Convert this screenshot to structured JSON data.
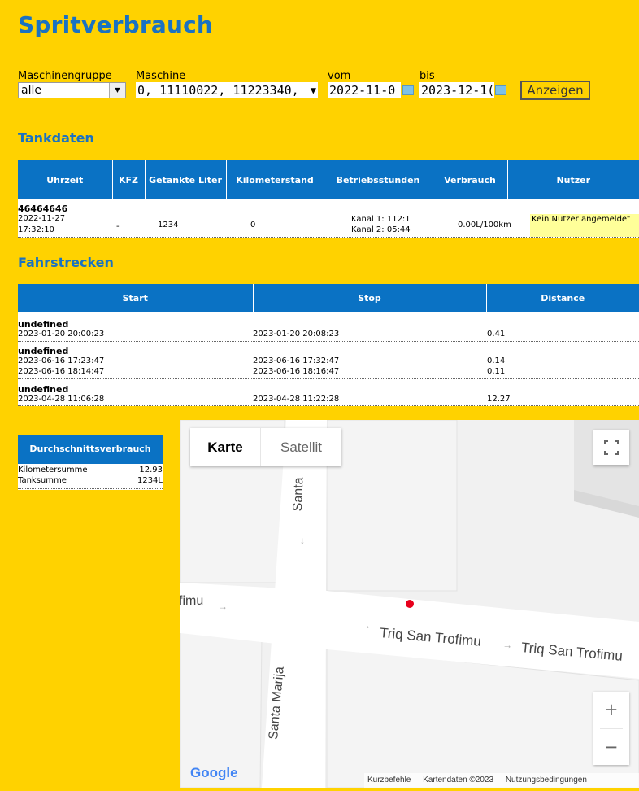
{
  "page": {
    "title": "Spritverbrauch"
  },
  "filters": {
    "group_label": "Maschinengruppe",
    "group_value": "alle",
    "machine_label": "Maschine",
    "machine_value": "0, 11110022, 11223340,",
    "from_label": "vom",
    "from_value": "2022-11-0",
    "to_label": "bis",
    "to_value": "2023-12-1(",
    "show_button": "Anzeigen"
  },
  "tank": {
    "heading": "Tankdaten",
    "columns": [
      "Uhrzeit",
      "KFZ",
      "Getankte Liter",
      "Kilometerstand",
      "Betriebsstunden",
      "Verbrauch",
      "Nutzer"
    ],
    "rows": [
      {
        "id": "46464646",
        "date": "2022-11-27",
        "time": "17:32:10",
        "kfz": "-",
        "liters": "1234",
        "km": "0",
        "hours_1": "Kanal 1: 112:1",
        "hours_2": "Kanal 2: 05:44",
        "consumption": "0.00L/100km",
        "user": "Kein Nutzer angemeldet"
      }
    ]
  },
  "trips": {
    "heading": "Fahrstrecken",
    "columns": [
      "Start",
      "Stop",
      "Distance"
    ],
    "groups": [
      {
        "name": "undefined",
        "rows": [
          {
            "start": "2023-01-20 20:00:23",
            "stop": "2023-01-20 20:08:23",
            "distance": "0.41"
          }
        ]
      },
      {
        "name": "undefined",
        "rows": [
          {
            "start": "2023-06-16 17:23:47",
            "stop": "2023-06-16 17:32:47",
            "distance": "0.14"
          },
          {
            "start": "2023-06-16 18:14:47",
            "stop": "2023-06-16 18:16:47",
            "distance": "0.11"
          }
        ]
      },
      {
        "name": "undefined",
        "rows": [
          {
            "start": "2023-04-28 11:06:28",
            "stop": "2023-04-28 11:22:28",
            "distance": "12.27"
          }
        ]
      }
    ]
  },
  "summary": {
    "heading": "Durchschnittsverbrauch",
    "km_label": "Kilometersumme",
    "km_value": "12.93",
    "tank_label": "Tanksumme",
    "tank_value": "1234L"
  },
  "map": {
    "tab_map": "Karte",
    "tab_satellite": "Satellit",
    "street_1": "Triq San Trofimu",
    "street_2": "Triq San Trofimu",
    "street_partial": "fimu",
    "street_vertical_top": "Santa",
    "street_vertical_bottom": "Santa Marija",
    "street_top_partial": "a",
    "logo": "Google",
    "shortcuts": "Kurzbefehle",
    "map_data": "Kartendaten ©2023",
    "terms": "Nutzungsbedingungen",
    "zoom_in": "+",
    "zoom_out": "−"
  },
  "colors": {
    "accent": "#1a72c2",
    "header_blue": "#0a72c4",
    "background": "#ffd200",
    "user_highlight": "#ffff99",
    "marker": "#e8001c"
  }
}
